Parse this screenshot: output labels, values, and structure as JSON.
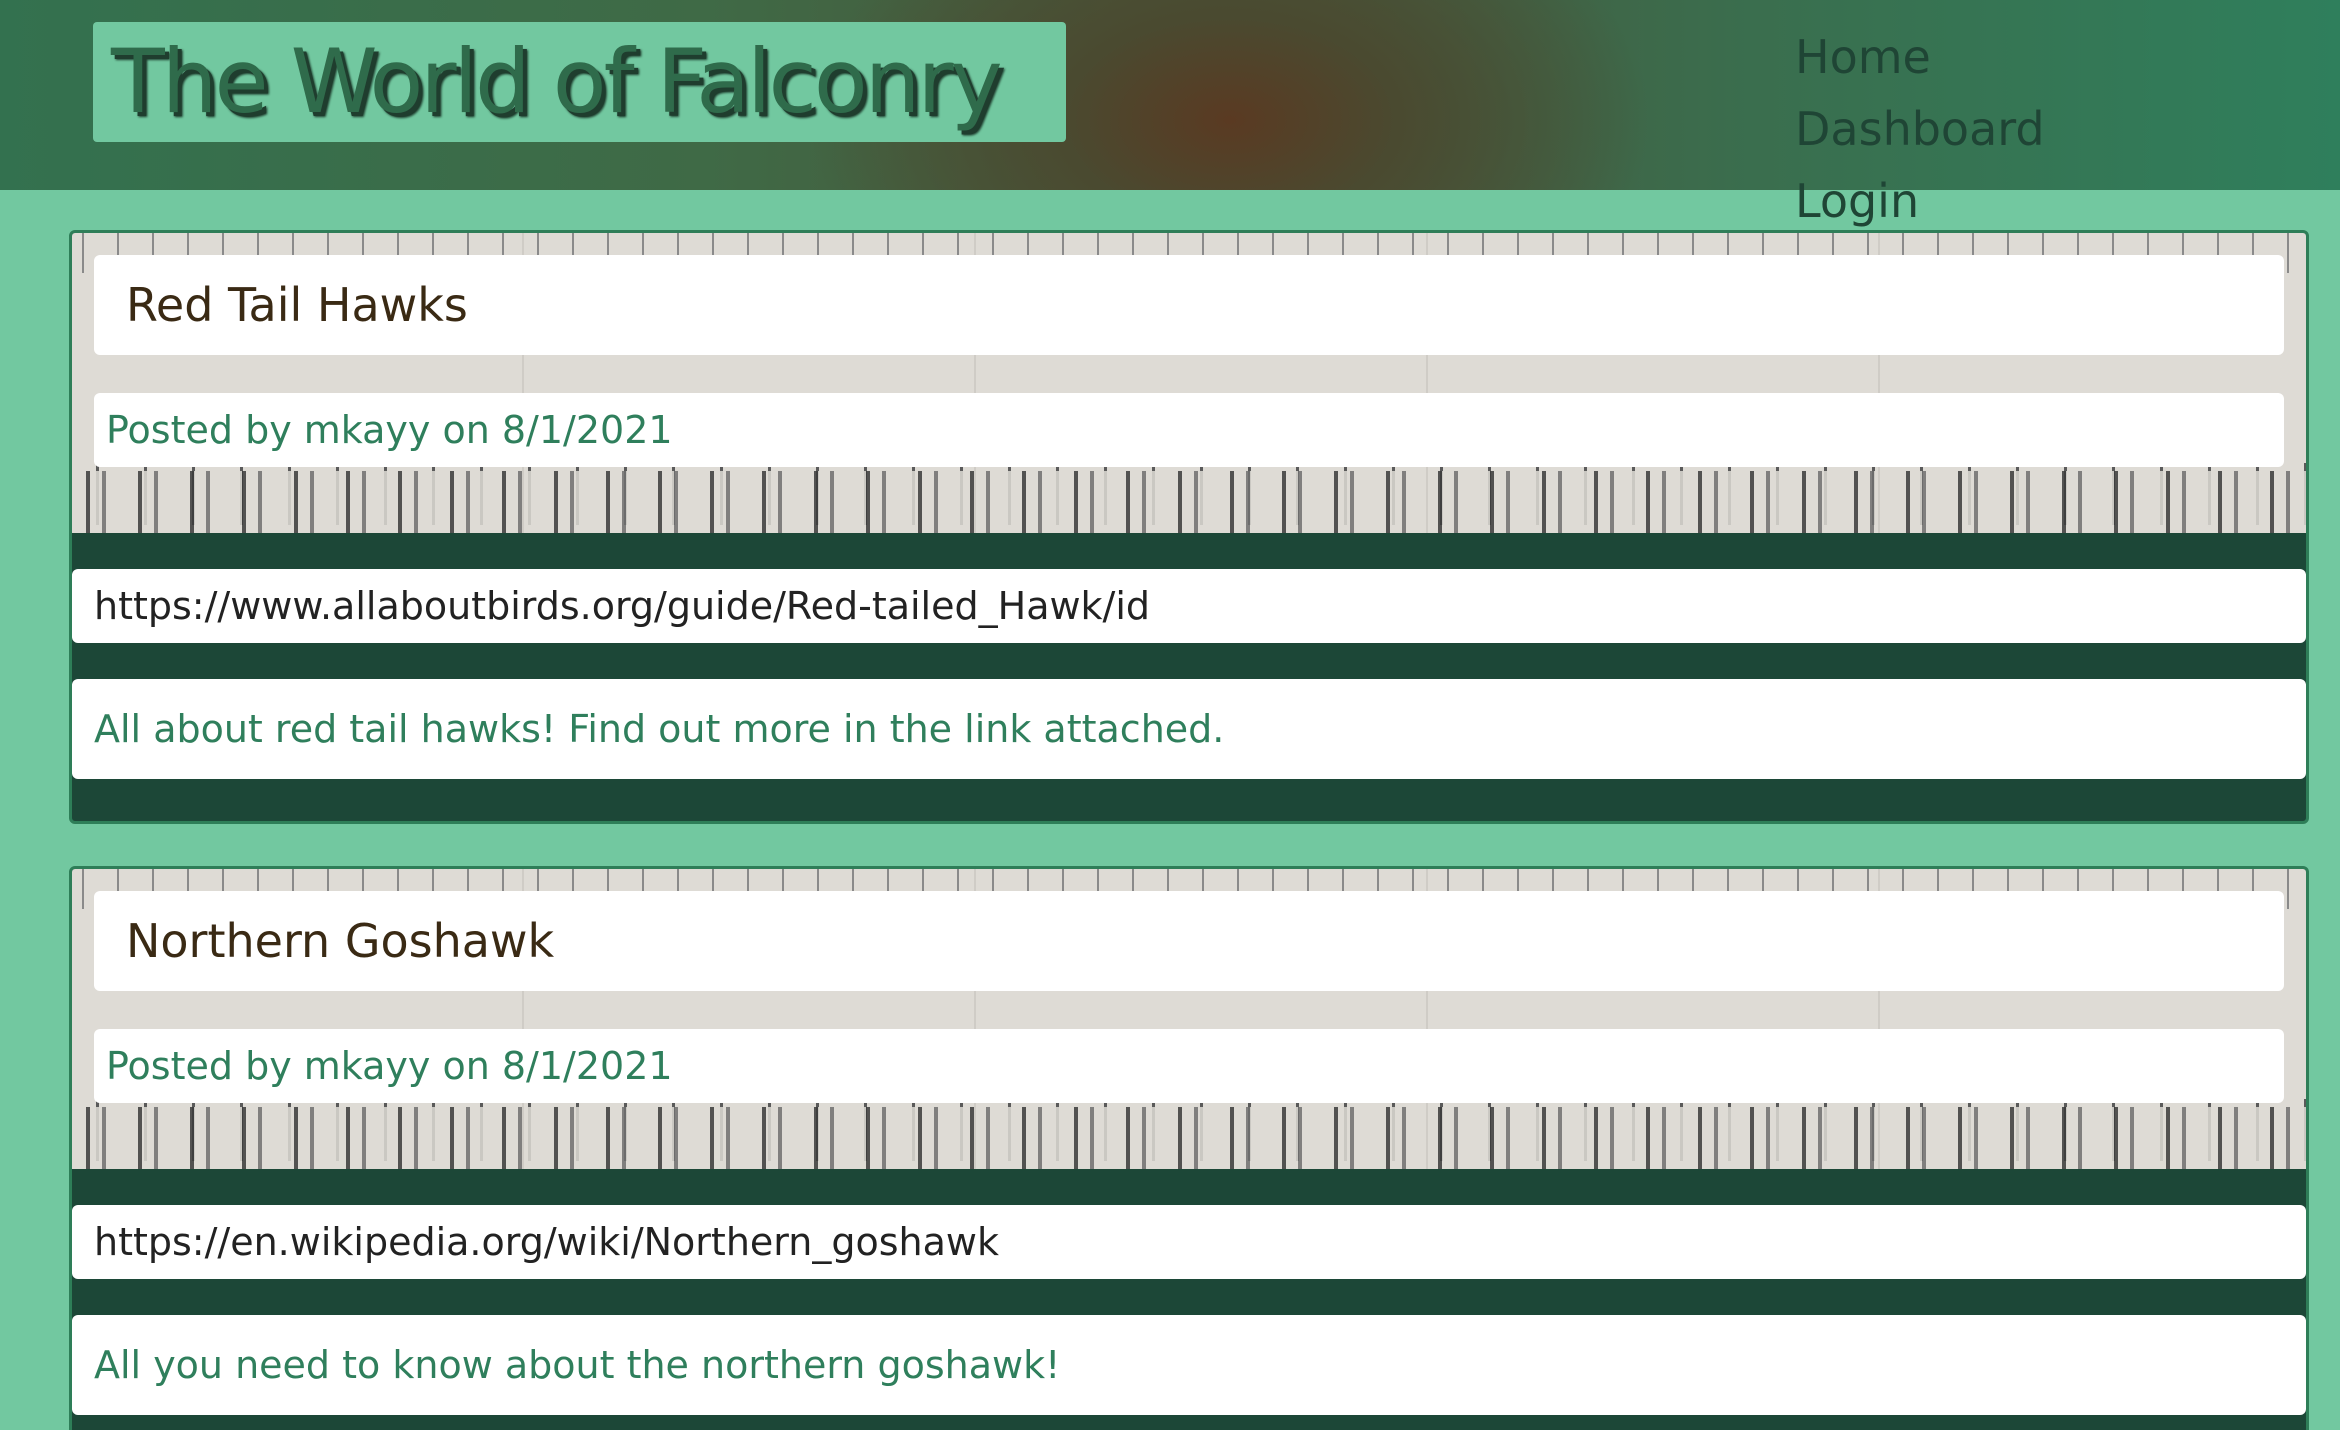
{
  "header": {
    "site_title": "The World of Falconry",
    "nav": [
      {
        "label": "Home"
      },
      {
        "label": "Dashboard"
      },
      {
        "label": "Login"
      }
    ]
  },
  "posts": [
    {
      "title": "Red Tail Hawks",
      "meta": "Posted by mkayy on 8/1/2021",
      "link": "https://www.allaboutbirds.org/guide/Red-tailed_Hawk/id",
      "body": "All about red tail hawks! Find out more in the link attached."
    },
    {
      "title": "Northern Goshawk",
      "meta": "Posted by mkayy on 8/1/2021",
      "link": "https://en.wikipedia.org/wiki/Northern_goshawk",
      "body": "All you need to know about the northern goshawk!"
    }
  ],
  "colors": {
    "page_background": "#72c8a0",
    "card_background": "#1c4737",
    "accent_text": "#2f7f5c",
    "title_text": "#3a2a14"
  }
}
